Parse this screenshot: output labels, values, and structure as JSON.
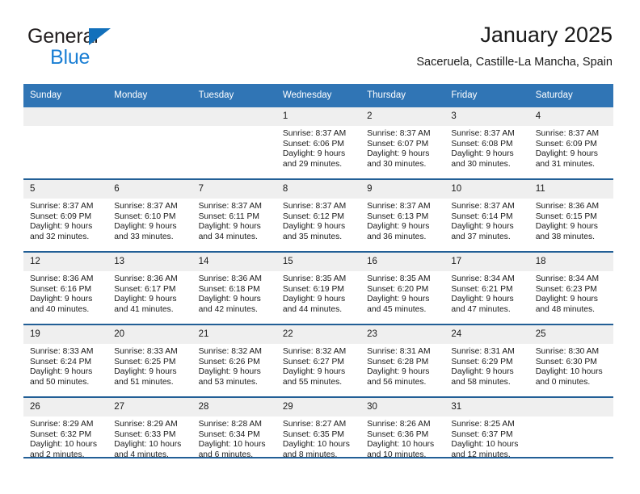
{
  "brand": {
    "name_top": "General",
    "name_bottom": "Blue",
    "triangle_color": "#1270bb",
    "bottom_color": "#1b7fd4"
  },
  "header": {
    "title": "January 2025",
    "subtitle": "Saceruela, Castille-La Mancha, Spain"
  },
  "theme": {
    "header_bg": "#3075b5",
    "header_text": "#ffffff",
    "row_divider": "#225f96",
    "daynum_bg": "#efefef"
  },
  "weekday_headers": [
    "Sunday",
    "Monday",
    "Tuesday",
    "Wednesday",
    "Thursday",
    "Friday",
    "Saturday"
  ],
  "weeks": [
    [
      {
        "day": "",
        "empty": true,
        "sunrise": "",
        "sunset": "",
        "daylight1": "",
        "daylight2": ""
      },
      {
        "day": "",
        "empty": true,
        "sunrise": "",
        "sunset": "",
        "daylight1": "",
        "daylight2": ""
      },
      {
        "day": "",
        "empty": true,
        "sunrise": "",
        "sunset": "",
        "daylight1": "",
        "daylight2": ""
      },
      {
        "day": "1",
        "empty": false,
        "sunrise": "Sunrise: 8:37 AM",
        "sunset": "Sunset: 6:06 PM",
        "daylight1": "Daylight: 9 hours",
        "daylight2": "and 29 minutes."
      },
      {
        "day": "2",
        "empty": false,
        "sunrise": "Sunrise: 8:37 AM",
        "sunset": "Sunset: 6:07 PM",
        "daylight1": "Daylight: 9 hours",
        "daylight2": "and 30 minutes."
      },
      {
        "day": "3",
        "empty": false,
        "sunrise": "Sunrise: 8:37 AM",
        "sunset": "Sunset: 6:08 PM",
        "daylight1": "Daylight: 9 hours",
        "daylight2": "and 30 minutes."
      },
      {
        "day": "4",
        "empty": false,
        "sunrise": "Sunrise: 8:37 AM",
        "sunset": "Sunset: 6:09 PM",
        "daylight1": "Daylight: 9 hours",
        "daylight2": "and 31 minutes."
      }
    ],
    [
      {
        "day": "5",
        "empty": false,
        "sunrise": "Sunrise: 8:37 AM",
        "sunset": "Sunset: 6:09 PM",
        "daylight1": "Daylight: 9 hours",
        "daylight2": "and 32 minutes."
      },
      {
        "day": "6",
        "empty": false,
        "sunrise": "Sunrise: 8:37 AM",
        "sunset": "Sunset: 6:10 PM",
        "daylight1": "Daylight: 9 hours",
        "daylight2": "and 33 minutes."
      },
      {
        "day": "7",
        "empty": false,
        "sunrise": "Sunrise: 8:37 AM",
        "sunset": "Sunset: 6:11 PM",
        "daylight1": "Daylight: 9 hours",
        "daylight2": "and 34 minutes."
      },
      {
        "day": "8",
        "empty": false,
        "sunrise": "Sunrise: 8:37 AM",
        "sunset": "Sunset: 6:12 PM",
        "daylight1": "Daylight: 9 hours",
        "daylight2": "and 35 minutes."
      },
      {
        "day": "9",
        "empty": false,
        "sunrise": "Sunrise: 8:37 AM",
        "sunset": "Sunset: 6:13 PM",
        "daylight1": "Daylight: 9 hours",
        "daylight2": "and 36 minutes."
      },
      {
        "day": "10",
        "empty": false,
        "sunrise": "Sunrise: 8:37 AM",
        "sunset": "Sunset: 6:14 PM",
        "daylight1": "Daylight: 9 hours",
        "daylight2": "and 37 minutes."
      },
      {
        "day": "11",
        "empty": false,
        "sunrise": "Sunrise: 8:36 AM",
        "sunset": "Sunset: 6:15 PM",
        "daylight1": "Daylight: 9 hours",
        "daylight2": "and 38 minutes."
      }
    ],
    [
      {
        "day": "12",
        "empty": false,
        "sunrise": "Sunrise: 8:36 AM",
        "sunset": "Sunset: 6:16 PM",
        "daylight1": "Daylight: 9 hours",
        "daylight2": "and 40 minutes."
      },
      {
        "day": "13",
        "empty": false,
        "sunrise": "Sunrise: 8:36 AM",
        "sunset": "Sunset: 6:17 PM",
        "daylight1": "Daylight: 9 hours",
        "daylight2": "and 41 minutes."
      },
      {
        "day": "14",
        "empty": false,
        "sunrise": "Sunrise: 8:36 AM",
        "sunset": "Sunset: 6:18 PM",
        "daylight1": "Daylight: 9 hours",
        "daylight2": "and 42 minutes."
      },
      {
        "day": "15",
        "empty": false,
        "sunrise": "Sunrise: 8:35 AM",
        "sunset": "Sunset: 6:19 PM",
        "daylight1": "Daylight: 9 hours",
        "daylight2": "and 44 minutes."
      },
      {
        "day": "16",
        "empty": false,
        "sunrise": "Sunrise: 8:35 AM",
        "sunset": "Sunset: 6:20 PM",
        "daylight1": "Daylight: 9 hours",
        "daylight2": "and 45 minutes."
      },
      {
        "day": "17",
        "empty": false,
        "sunrise": "Sunrise: 8:34 AM",
        "sunset": "Sunset: 6:21 PM",
        "daylight1": "Daylight: 9 hours",
        "daylight2": "and 47 minutes."
      },
      {
        "day": "18",
        "empty": false,
        "sunrise": "Sunrise: 8:34 AM",
        "sunset": "Sunset: 6:23 PM",
        "daylight1": "Daylight: 9 hours",
        "daylight2": "and 48 minutes."
      }
    ],
    [
      {
        "day": "19",
        "empty": false,
        "sunrise": "Sunrise: 8:33 AM",
        "sunset": "Sunset: 6:24 PM",
        "daylight1": "Daylight: 9 hours",
        "daylight2": "and 50 minutes."
      },
      {
        "day": "20",
        "empty": false,
        "sunrise": "Sunrise: 8:33 AM",
        "sunset": "Sunset: 6:25 PM",
        "daylight1": "Daylight: 9 hours",
        "daylight2": "and 51 minutes."
      },
      {
        "day": "21",
        "empty": false,
        "sunrise": "Sunrise: 8:32 AM",
        "sunset": "Sunset: 6:26 PM",
        "daylight1": "Daylight: 9 hours",
        "daylight2": "and 53 minutes."
      },
      {
        "day": "22",
        "empty": false,
        "sunrise": "Sunrise: 8:32 AM",
        "sunset": "Sunset: 6:27 PM",
        "daylight1": "Daylight: 9 hours",
        "daylight2": "and 55 minutes."
      },
      {
        "day": "23",
        "empty": false,
        "sunrise": "Sunrise: 8:31 AM",
        "sunset": "Sunset: 6:28 PM",
        "daylight1": "Daylight: 9 hours",
        "daylight2": "and 56 minutes."
      },
      {
        "day": "24",
        "empty": false,
        "sunrise": "Sunrise: 8:31 AM",
        "sunset": "Sunset: 6:29 PM",
        "daylight1": "Daylight: 9 hours",
        "daylight2": "and 58 minutes."
      },
      {
        "day": "25",
        "empty": false,
        "sunrise": "Sunrise: 8:30 AM",
        "sunset": "Sunset: 6:30 PM",
        "daylight1": "Daylight: 10 hours",
        "daylight2": "and 0 minutes."
      }
    ],
    [
      {
        "day": "26",
        "empty": false,
        "sunrise": "Sunrise: 8:29 AM",
        "sunset": "Sunset: 6:32 PM",
        "daylight1": "Daylight: 10 hours",
        "daylight2": "and 2 minutes."
      },
      {
        "day": "27",
        "empty": false,
        "sunrise": "Sunrise: 8:29 AM",
        "sunset": "Sunset: 6:33 PM",
        "daylight1": "Daylight: 10 hours",
        "daylight2": "and 4 minutes."
      },
      {
        "day": "28",
        "empty": false,
        "sunrise": "Sunrise: 8:28 AM",
        "sunset": "Sunset: 6:34 PM",
        "daylight1": "Daylight: 10 hours",
        "daylight2": "and 6 minutes."
      },
      {
        "day": "29",
        "empty": false,
        "sunrise": "Sunrise: 8:27 AM",
        "sunset": "Sunset: 6:35 PM",
        "daylight1": "Daylight: 10 hours",
        "daylight2": "and 8 minutes."
      },
      {
        "day": "30",
        "empty": false,
        "sunrise": "Sunrise: 8:26 AM",
        "sunset": "Sunset: 6:36 PM",
        "daylight1": "Daylight: 10 hours",
        "daylight2": "and 10 minutes."
      },
      {
        "day": "31",
        "empty": false,
        "sunrise": "Sunrise: 8:25 AM",
        "sunset": "Sunset: 6:37 PM",
        "daylight1": "Daylight: 10 hours",
        "daylight2": "and 12 minutes."
      },
      {
        "day": "",
        "empty": true,
        "sunrise": "",
        "sunset": "",
        "daylight1": "",
        "daylight2": ""
      }
    ]
  ]
}
